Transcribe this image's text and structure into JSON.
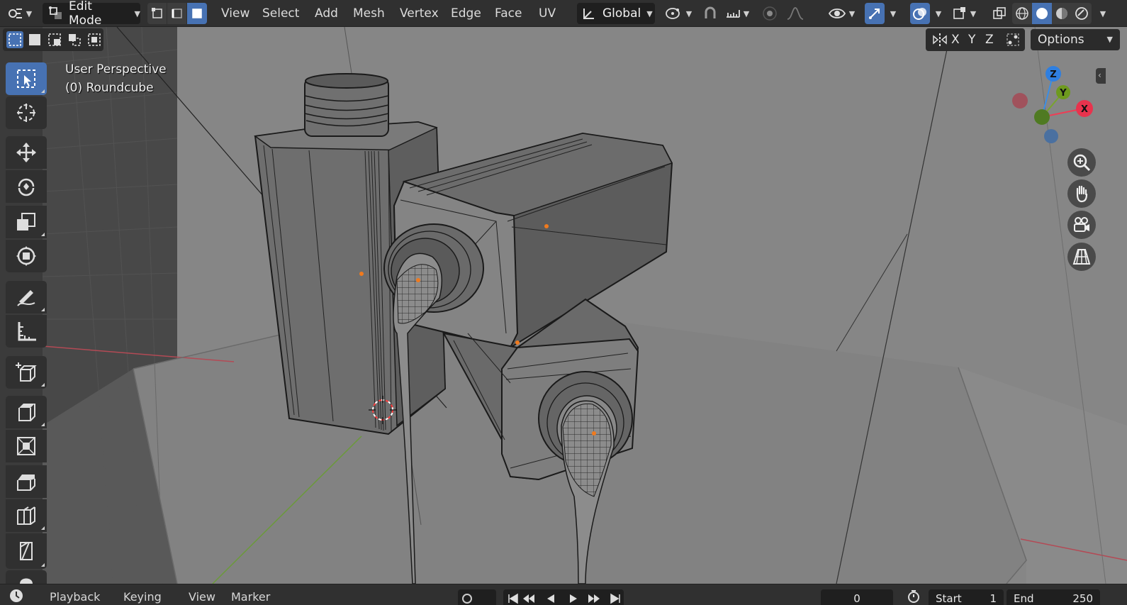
{
  "header": {
    "mode": "Edit Mode",
    "menus": [
      "View",
      "Select",
      "Add",
      "Mesh",
      "Vertex",
      "Edge",
      "Face",
      "UV"
    ],
    "transform_orientation": "Global",
    "icons": [
      "editor-type-icon",
      "edit-mode-icon",
      "vertex-select-icon",
      "edge-select-icon",
      "face-select-icon",
      "orientation-icon",
      "pivot-icon",
      "snap-icon",
      "snap-increment-icon",
      "proportional-edit-icon",
      "falloff-icon",
      "visibility-icon",
      "gizmo-icon",
      "overlay-icon",
      "mesh-overlay-icon",
      "xray-icon",
      "wireframe-shading-icon",
      "solid-shading-icon",
      "material-shading-icon",
      "rendered-shading-icon"
    ]
  },
  "viewport": {
    "view_name": "User Perspective",
    "object_name": "(0) Roundcube",
    "axis_lock": {
      "x": "X",
      "y": "Y",
      "z": "Z"
    },
    "options_label": "Options",
    "gizmo": {
      "x": "X",
      "y": "Y",
      "z": "Z"
    },
    "colors": {
      "x_axis": "#ee3d55",
      "y_axis": "#79a42c",
      "z_axis": "#3a8ee6",
      "active_tool": "#4772b3",
      "vertex": "#f07a1e"
    }
  },
  "toolbar": {
    "tools": [
      "select-box",
      "cursor",
      "move",
      "rotate",
      "scale",
      "transform",
      "annotate",
      "measure",
      "add-cube",
      "extrude-region",
      "inset-faces",
      "bevel",
      "loop-cut",
      "knife"
    ],
    "active_tool": "select-box"
  },
  "navigation": [
    "zoom",
    "pan",
    "camera",
    "perspective-toggle"
  ],
  "timeline": {
    "menus": [
      "Playback",
      "Keying",
      "View",
      "Marker"
    ],
    "current_frame": "0",
    "start_label": "Start",
    "start_value": "1",
    "end_label": "End",
    "end_value": "250"
  }
}
